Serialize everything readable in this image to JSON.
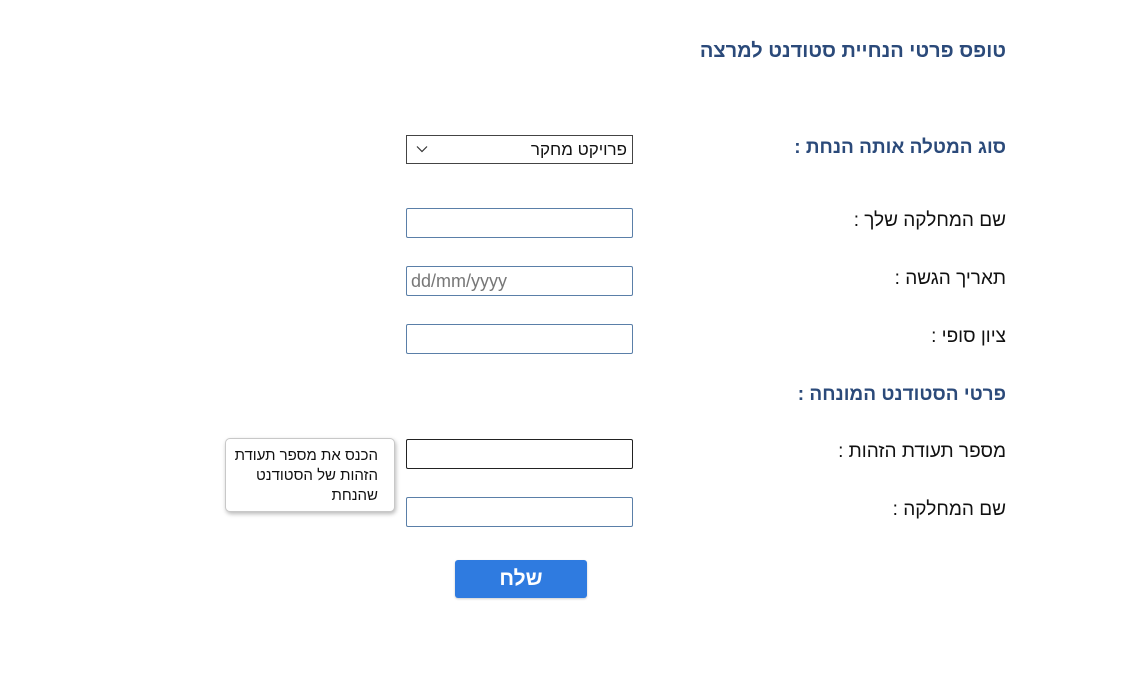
{
  "form": {
    "title": "טופס פרטי הנחיית סטודנט למרצה",
    "task_type_label": "סוג המטלה אותה הנחת :",
    "task_type_value": "פרויקט מחקר",
    "department_label": "שם המחלקה שלך :",
    "department_value": "",
    "submission_date_label": "תאריך הגשה :",
    "submission_date_placeholder": "dd/mm/yyyy",
    "final_grade_label": "ציון סופי :",
    "final_grade_value": "",
    "student_section_heading": "פרטי הסטודנט המונחה :",
    "student_id_label": "מספר תעודת הזהות :",
    "student_id_value": "",
    "student_department_label": "שם המחלקה :",
    "student_department_value": "",
    "tooltip_text": "הכנס את מספר תעודת הזהות של הסטודנט שהנחת",
    "submit_label": "שלח"
  },
  "icons": {
    "select_arrow": "chevron-down-icon"
  },
  "colors": {
    "heading": "#2b4a7a",
    "submit_button": "#2f7be0",
    "field_border": "#5a7fa8"
  }
}
